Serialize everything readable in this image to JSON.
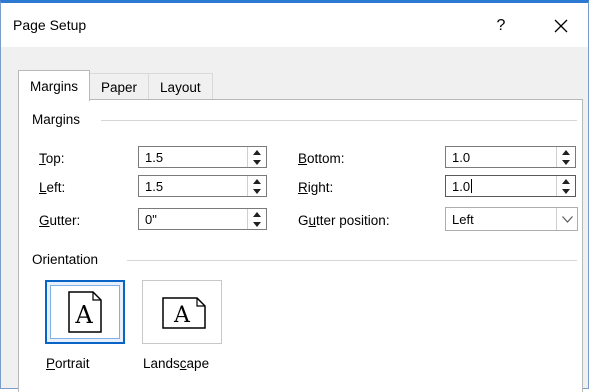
{
  "window": {
    "title": "Page Setup",
    "help_label": "?",
    "close_label": "close"
  },
  "tabs": [
    {
      "label": "Margins",
      "active": true
    },
    {
      "label": "Paper",
      "active": false
    },
    {
      "label": "Layout",
      "active": false
    }
  ],
  "margins": {
    "group_label": "Margins",
    "top": {
      "label_key": "T",
      "label_rest": "op:",
      "value": "1.5"
    },
    "left": {
      "label_key": "L",
      "label_rest": "eft:",
      "value": "1.5"
    },
    "gutter": {
      "label_key": "G",
      "label_rest": "utter:",
      "value": "0\""
    },
    "bottom": {
      "label_key": "B",
      "label_rest": "ottom:",
      "value": "1.0"
    },
    "right": {
      "label_key": "R",
      "label_rest": "ight:",
      "value": "1.0"
    },
    "gutter_position": {
      "label_pre": "G",
      "label_key": "u",
      "label_rest": "tter position:",
      "value": "Left"
    }
  },
  "orientation": {
    "group_label": "Orientation",
    "portrait": {
      "label_key": "P",
      "label_rest": "ortrait",
      "glyph": "A",
      "selected": true
    },
    "landscape": {
      "label_pre": "Lands",
      "label_key": "c",
      "label_rest": "ape",
      "glyph": "A",
      "selected": false
    }
  },
  "colors": {
    "accent": "#0a64c8",
    "title_border": "#2b79d0"
  }
}
